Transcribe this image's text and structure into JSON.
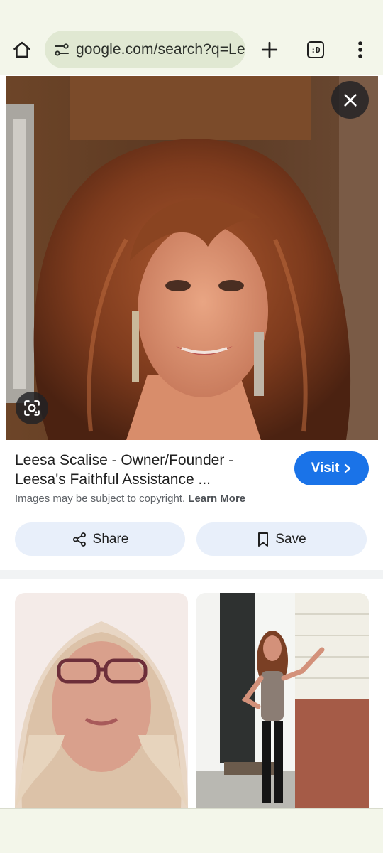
{
  "browser": {
    "url": "google.com/search?q=Le",
    "tab_count": ":D",
    "colors": {
      "toolbar_bg": "#f3f6ea",
      "urlbar_bg": "#e0e8d2"
    }
  },
  "viewer": {
    "result": {
      "title": "Leesa Scalise - Owner/Founder - Leesa's Faithful Assistance ...",
      "copyright_text": "Images may be subject to copyright.",
      "learn_more": "Learn More",
      "visit_label": "Visit",
      "share_label": "Share",
      "save_label": "Save"
    },
    "colors": {
      "accent": "#1a73e8",
      "pill_bg": "#e8effa"
    }
  },
  "icons": {
    "home": "home-icon",
    "site_info": "tune-icon",
    "new_tab": "plus-icon",
    "tabs": "tab-switcher-icon",
    "menu": "more-vert-icon",
    "close": "close-icon",
    "lens": "lens-icon",
    "visit_chevron": "chevron-right-icon",
    "share": "share-icon",
    "save": "bookmark-icon"
  }
}
